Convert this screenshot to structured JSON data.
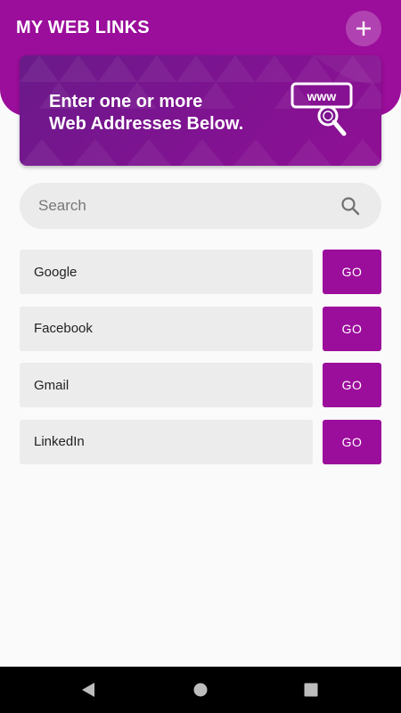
{
  "header": {
    "title": "MY WEB LINKS",
    "add_icon": "plus-icon"
  },
  "banner": {
    "line1": "Enter one or more",
    "line2": "Web Addresses Below.",
    "icon": "www-search-icon",
    "icon_text": "www"
  },
  "search": {
    "placeholder": "Search",
    "value": "",
    "icon": "search-icon"
  },
  "links": [
    {
      "label": "Google",
      "button": "GO"
    },
    {
      "label": "Facebook",
      "button": "GO"
    },
    {
      "label": "Gmail",
      "button": "GO"
    },
    {
      "label": "LinkedIn",
      "button": "GO"
    }
  ],
  "nav": {
    "back_icon": "back-triangle-icon",
    "home_icon": "home-circle-icon",
    "recents_icon": "recents-square-icon"
  },
  "colors": {
    "primary": "#9b0d9b",
    "banner_start": "#6a1a8a",
    "field_bg": "#ececec",
    "background": "#fafafa",
    "nav_bg": "#000000"
  }
}
